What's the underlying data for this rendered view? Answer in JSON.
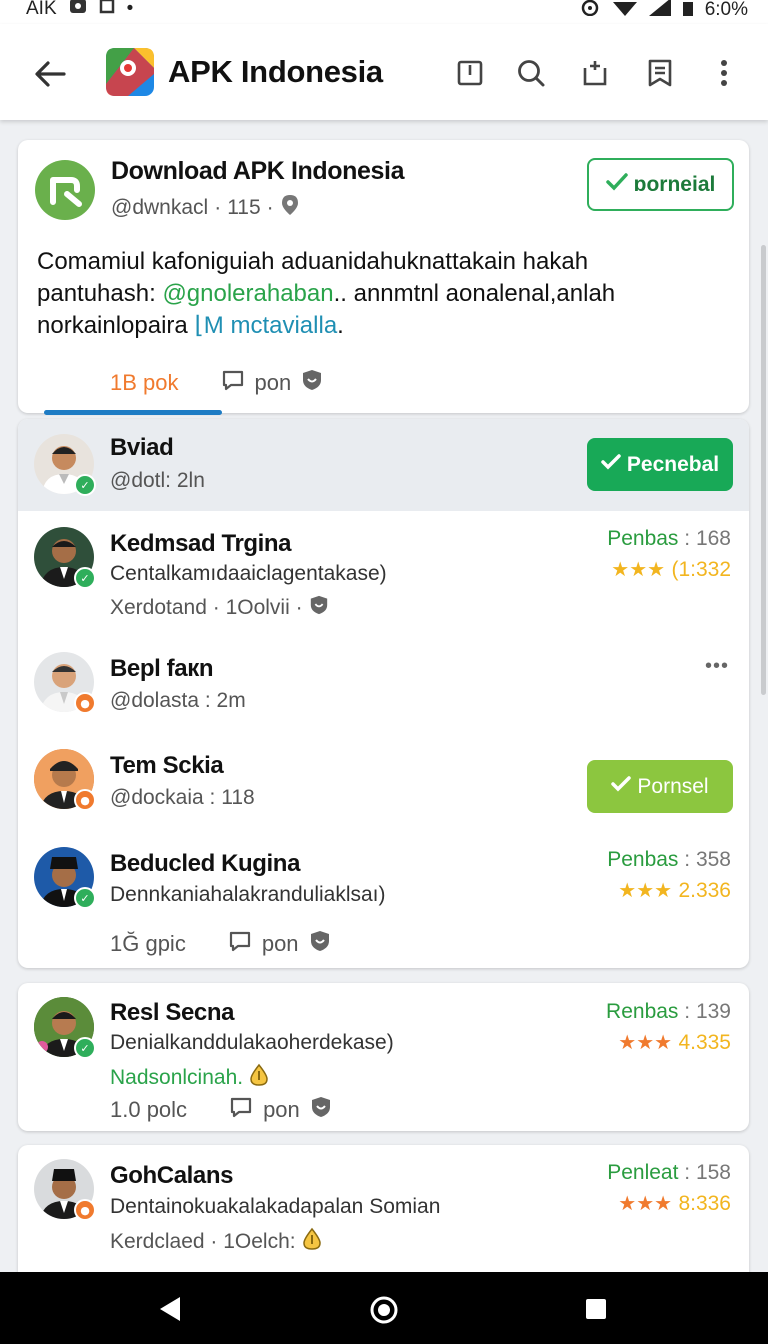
{
  "status_bar": {
    "left_text": "AIK",
    "battery": "6:0%"
  },
  "app_bar": {
    "title": "APK Indonesia"
  },
  "post": {
    "title": "Download APK Indonesia",
    "handle": "@dwnkacl",
    "meta_count": "115",
    "follow_label": "ɒorneial",
    "body_line1": "Comamiul kafoniguiah aduanidahuknattakain hakah",
    "body_line2_pre": "pantuhash: ",
    "body_link": "@gnolerahaban",
    "body_line2_post": ".. annmtnl aonalenal,anlah",
    "body_line3_pre": "norkainlopaira ",
    "body_link2": "mctavialla",
    "body_line3_post": ".",
    "likes": "1B pok",
    "comments": "pon"
  },
  "highlight_user": {
    "name": "Bviad",
    "handle": "@dotl: 2ln",
    "button": "Pecnebal"
  },
  "users": [
    {
      "name": "Kedmsad Trgina",
      "desc": "Centalkamıdaaiclagentakase)",
      "meta": "Xerdotand · 1Oolvii ·",
      "rating_label": "Penbas",
      "rating_count": "168",
      "stars": "★★★",
      "rating_value": "(1:332"
    },
    {
      "name": "Bepl faкn",
      "handle": "@dolasta : 2m",
      "more": "•••"
    },
    {
      "name": "Tem Sckia",
      "handle": "@dockaia : 118",
      "button": "Pornsel"
    },
    {
      "name": "Beducled Kugina",
      "desc": "Dennkaniahalakranduliaklsaı)",
      "rating_label": "Penbas",
      "rating_count": "358",
      "stars": "★★★",
      "rating_value": "2.336",
      "likes": "1Ğ gpic",
      "comments": "pon"
    }
  ],
  "card2": {
    "name": "Resl Secna",
    "desc": "Denialkanddulakaoherdekase)",
    "status": "Nadsonlcinah.",
    "rating_label": "Renbas",
    "rating_count": "139",
    "stars": "★★★",
    "rating_value": "4.335",
    "likes": "1.0 polc",
    "comments": "pon"
  },
  "card3": {
    "name": "GohCalans",
    "desc": "Dentainokuakalakadapalan Somian",
    "meta": "Kerdclaed · 1Oelch:",
    "rating_label": "Penleat",
    "rating_count": "158",
    "stars": "★★★",
    "rating_value": "8:336"
  },
  "colors": {
    "green": "#2fae5b",
    "lime": "#8cc63f",
    "link": "#1f8fb3",
    "orange": "#f07a2e",
    "accent_blue": "#1e7cc4"
  }
}
